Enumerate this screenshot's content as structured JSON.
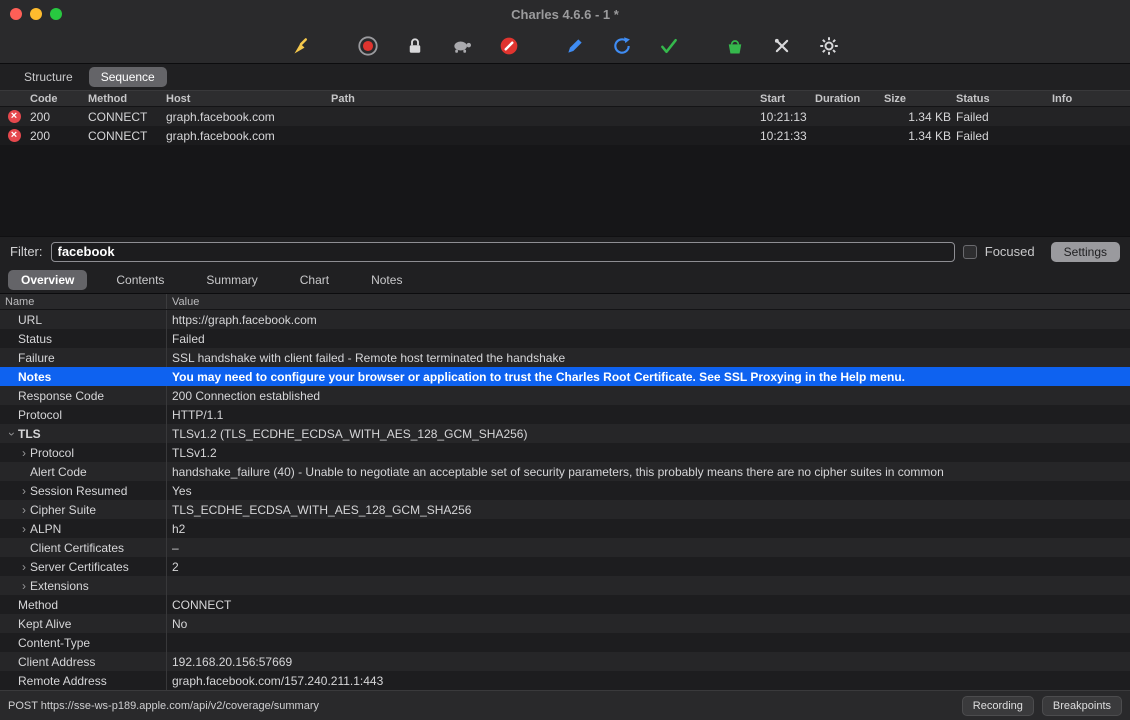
{
  "window": {
    "title": "Charles 4.6.6 - 1 *"
  },
  "toolbar": {
    "icons": [
      "broom-icon",
      "record-icon",
      "lock-icon",
      "throttle-turtle-icon",
      "block-icon",
      "compose-pencil-icon",
      "repeat-icon",
      "validate-check-icon",
      "gift-icon",
      "tools-icon",
      "gear-icon"
    ]
  },
  "view_tabs": [
    {
      "label": "Structure",
      "selected": false
    },
    {
      "label": "Sequence",
      "selected": true
    }
  ],
  "sequence": {
    "columns": [
      "Code",
      "Method",
      "Host",
      "Path",
      "Start",
      "Duration",
      "Size",
      "Status",
      "Info"
    ],
    "rows": [
      {
        "icon": "failed-x-icon",
        "code": "200",
        "method": "CONNECT",
        "host": "graph.facebook.com",
        "path": "",
        "start": "10:21:13",
        "duration": "",
        "size": "1.34 KB",
        "status": "Failed",
        "info": ""
      },
      {
        "icon": "failed-x-icon",
        "code": "200",
        "method": "CONNECT",
        "host": "graph.facebook.com",
        "path": "",
        "start": "10:21:33",
        "duration": "",
        "size": "1.34 KB",
        "status": "Failed",
        "info": ""
      }
    ]
  },
  "filter": {
    "label": "Filter:",
    "value": "facebook",
    "focused_label": "Focused",
    "focused_checked": false,
    "settings_label": "Settings"
  },
  "detail_tabs": [
    {
      "label": "Overview",
      "selected": true
    },
    {
      "label": "Contents",
      "selected": false
    },
    {
      "label": "Summary",
      "selected": false
    },
    {
      "label": "Chart",
      "selected": false
    },
    {
      "label": "Notes",
      "selected": false
    }
  ],
  "detail": {
    "columns": [
      "Name",
      "Value"
    ],
    "rows": [
      {
        "name": "URL",
        "value": "https://graph.facebook.com"
      },
      {
        "name": "Status",
        "value": "Failed"
      },
      {
        "name": "Failure",
        "value": "SSL handshake with client failed - Remote host terminated the handshake"
      },
      {
        "name": "Notes",
        "value": "You may need to configure your browser or application to trust the Charles Root Certificate. See SSL Proxying in the Help menu.",
        "selected": true
      },
      {
        "name": "Response Code",
        "value": "200 Connection established"
      },
      {
        "name": "Protocol",
        "value": "HTTP/1.1"
      },
      {
        "name": "TLS",
        "value": "TLSv1.2 (TLS_ECDHE_ECDSA_WITH_AES_128_GCM_SHA256)",
        "chevron": "down",
        "bold": true
      },
      {
        "name": "Protocol",
        "value": "TLSv1.2",
        "indent": 1,
        "chevron": "right"
      },
      {
        "name": "Alert Code",
        "value": "handshake_failure (40) - Unable to negotiate an acceptable set of security parameters, this probably means there are no cipher suites in common",
        "indent": 1
      },
      {
        "name": "Session Resumed",
        "value": "Yes",
        "indent": 1,
        "chevron": "right"
      },
      {
        "name": "Cipher Suite",
        "value": "TLS_ECDHE_ECDSA_WITH_AES_128_GCM_SHA256",
        "indent": 1,
        "chevron": "right"
      },
      {
        "name": "ALPN",
        "value": "h2",
        "indent": 1,
        "chevron": "right"
      },
      {
        "name": "Client Certificates",
        "value": "–",
        "indent": 1
      },
      {
        "name": "Server Certificates",
        "value": "2",
        "indent": 1,
        "chevron": "right"
      },
      {
        "name": "Extensions",
        "value": "",
        "indent": 1,
        "chevron": "right"
      },
      {
        "name": "Method",
        "value": "CONNECT"
      },
      {
        "name": "Kept Alive",
        "value": "No"
      },
      {
        "name": "Content-Type",
        "value": ""
      },
      {
        "name": "Client Address",
        "value": "192.168.20.156:57669"
      },
      {
        "name": "Remote Address",
        "value": "graph.facebook.com/157.240.211.1:443"
      }
    ]
  },
  "status_bar": {
    "text": "POST https://sse-ws-p189.apple.com/api/v2/coverage/summary",
    "buttons": [
      {
        "label": "Recording"
      },
      {
        "label": "Breakpoints"
      }
    ]
  },
  "colors": {
    "selection_blue": "#0e62f0",
    "failed_red": "#e5484d",
    "accent_blue": "#3f8cf3",
    "accent_green": "#35b84c",
    "accent_yellow": "#f5c84c"
  }
}
